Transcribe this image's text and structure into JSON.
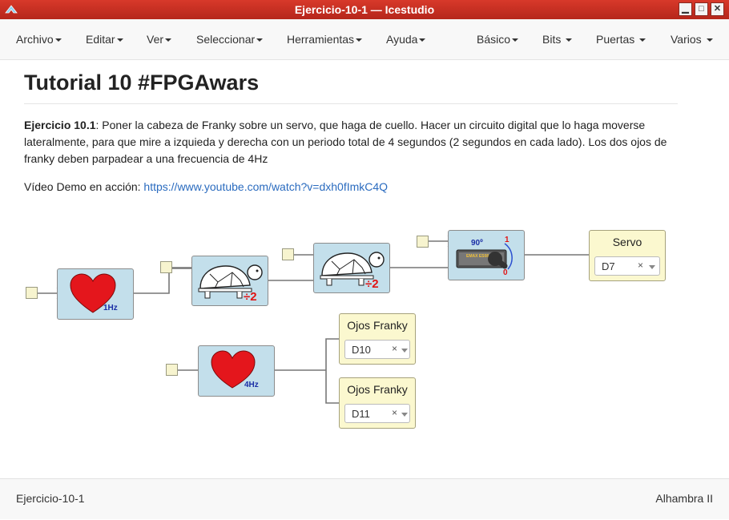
{
  "window": {
    "title": "Ejercicio-10-1 — Icestudio"
  },
  "menubar": {
    "archivo": "Archivo",
    "editar": "Editar",
    "ver": "Ver",
    "seleccionar": "Seleccionar",
    "herramientas": "Herramientas",
    "ayuda": "Ayuda",
    "basico": "Básico",
    "bits": "Bits",
    "puertas": "Puertas",
    "varios": "Varios"
  },
  "doc": {
    "title": "Tutorial 10 #FPGAwars",
    "exercise_label": "Ejercicio 10.1",
    "exercise_text": ": Poner la cabeza de Franky sobre un servo, que haga de cuello. Hacer un circuito digital que lo haga moverse lateralmente, para que mire a izquieda y derecha con un periodo total de 4 segundos (2 segundos en cada lado). Los dos ojos de franky deben parpadear a una frecuencia de 4Hz",
    "demo_label": "Vídeo Demo en acción: ",
    "demo_link": "https://www.youtube.com/watch?v=dxh0fImkC4Q"
  },
  "circuit": {
    "heart1_freq": "1Hz",
    "heart2_freq": "4Hz",
    "div1_label": "÷2",
    "div2_label": "÷2",
    "servo_top": "90º",
    "servo_one": "1",
    "servo_zero": "0",
    "servo_chip": "EMAX ES08A",
    "out_servo": {
      "title": "Servo",
      "value": "D7"
    },
    "out_eyes1": {
      "title": "Ojos Franky",
      "value": "D10"
    },
    "out_eyes2": {
      "title": "Ojos Franky",
      "value": "D11"
    },
    "clear_symbol": "×"
  },
  "status": {
    "file": "Ejercicio-10-1",
    "board": "Alhambra II"
  }
}
